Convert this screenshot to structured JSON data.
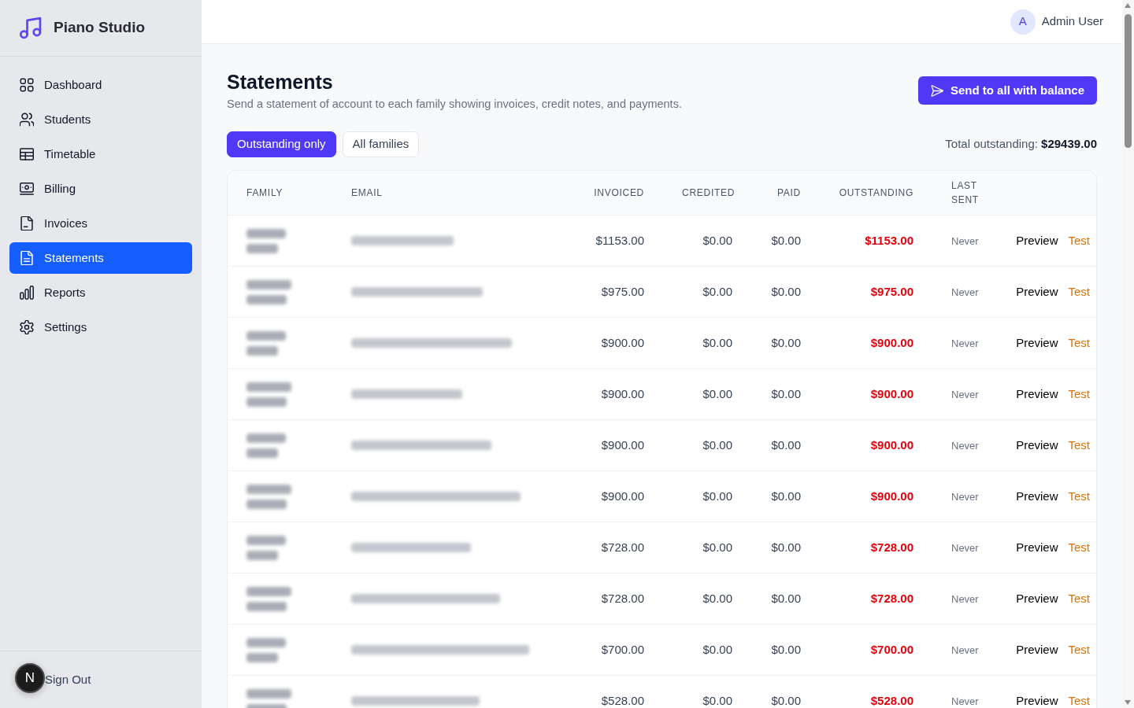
{
  "app": {
    "name": "Piano Studio"
  },
  "sidebar": {
    "items": [
      {
        "label": "Dashboard",
        "selected": false
      },
      {
        "label": "Students",
        "selected": false
      },
      {
        "label": "Timetable",
        "selected": false
      },
      {
        "label": "Billing",
        "selected": false
      },
      {
        "label": "Invoices",
        "selected": false
      },
      {
        "label": "Statements",
        "selected": true
      },
      {
        "label": "Reports",
        "selected": false
      },
      {
        "label": "Settings",
        "selected": false
      }
    ],
    "sign_out": "Sign Out"
  },
  "dev_badge": {
    "label": "N"
  },
  "header": {
    "user": {
      "initial": "A",
      "name": "Admin User"
    }
  },
  "page": {
    "title": "Statements",
    "subtitle": "Send a statement of account to each family showing invoices, credit notes, and payments.",
    "primary_action": "Send to all with balance"
  },
  "filters": [
    {
      "label": "Outstanding only",
      "selected": true
    },
    {
      "label": "All families",
      "selected": false
    }
  ],
  "total": {
    "label": "Total outstanding:",
    "value": "$29439.00"
  },
  "table": {
    "columns": [
      "FAMILY",
      "EMAIL",
      "INVOICED",
      "CREDITED",
      "PAID",
      "OUTSTANDING",
      "LAST SENT"
    ],
    "rows": [
      {
        "invoiced": "$1153.00",
        "credited": "$0.00",
        "paid": "$0.00",
        "outstanding": "$1153.00",
        "last_sent": "Never",
        "actions": [
          {
            "kind": "preview",
            "label": "Preview"
          },
          {
            "kind": "test",
            "label": "Test"
          }
        ]
      },
      {
        "invoiced": "$975.00",
        "credited": "$0.00",
        "paid": "$0.00",
        "outstanding": "$975.00",
        "last_sent": "Never",
        "actions": [
          {
            "kind": "preview",
            "label": "Preview"
          },
          {
            "kind": "test",
            "label": "Test"
          }
        ]
      },
      {
        "invoiced": "$900.00",
        "credited": "$0.00",
        "paid": "$0.00",
        "outstanding": "$900.00",
        "last_sent": "Never",
        "actions": [
          {
            "kind": "preview",
            "label": "Preview"
          },
          {
            "kind": "test",
            "label": "Test"
          }
        ]
      },
      {
        "invoiced": "$900.00",
        "credited": "$0.00",
        "paid": "$0.00",
        "outstanding": "$900.00",
        "last_sent": "Never",
        "actions": [
          {
            "kind": "preview",
            "label": "Preview"
          },
          {
            "kind": "test",
            "label": "Test"
          }
        ]
      },
      {
        "invoiced": "$900.00",
        "credited": "$0.00",
        "paid": "$0.00",
        "outstanding": "$900.00",
        "last_sent": "Never",
        "actions": [
          {
            "kind": "preview",
            "label": "Preview"
          },
          {
            "kind": "test",
            "label": "Test"
          }
        ]
      },
      {
        "invoiced": "$900.00",
        "credited": "$0.00",
        "paid": "$0.00",
        "outstanding": "$900.00",
        "last_sent": "Never",
        "actions": [
          {
            "kind": "preview",
            "label": "Preview"
          },
          {
            "kind": "test",
            "label": "Test"
          }
        ]
      },
      {
        "invoiced": "$728.00",
        "credited": "$0.00",
        "paid": "$0.00",
        "outstanding": "$728.00",
        "last_sent": "Never",
        "actions": [
          {
            "kind": "preview",
            "label": "Preview"
          },
          {
            "kind": "test",
            "label": "Test"
          }
        ]
      },
      {
        "invoiced": "$728.00",
        "credited": "$0.00",
        "paid": "$0.00",
        "outstanding": "$728.00",
        "last_sent": "Never",
        "actions": [
          {
            "kind": "preview",
            "label": "Preview"
          },
          {
            "kind": "test",
            "label": "Test"
          }
        ]
      },
      {
        "invoiced": "$700.00",
        "credited": "$0.00",
        "paid": "$0.00",
        "outstanding": "$700.00",
        "last_sent": "Never",
        "actions": [
          {
            "kind": "preview",
            "label": "Preview"
          },
          {
            "kind": "test",
            "label": "Test"
          }
        ]
      },
      {
        "invoiced": "$528.00",
        "credited": "$0.00",
        "paid": "$0.00",
        "outstanding": "$528.00",
        "last_sent": "Never",
        "actions": [
          {
            "kind": "preview",
            "label": "Preview"
          },
          {
            "kind": "test",
            "label": "Test"
          }
        ]
      }
    ]
  }
}
